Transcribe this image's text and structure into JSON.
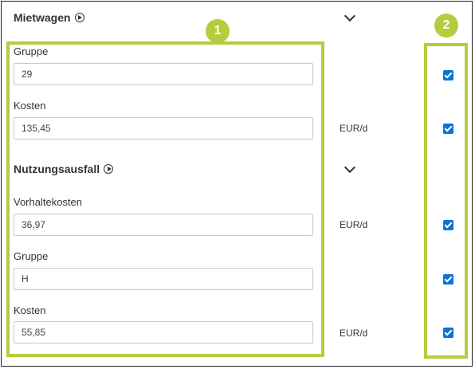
{
  "sections": {
    "mietwagen": {
      "title": "Mietwagen"
    },
    "nutzungsausfall": {
      "title": "Nutzungsausfall"
    }
  },
  "fields": {
    "mietwagen_gruppe": {
      "label": "Gruppe",
      "value": "29",
      "checked": true
    },
    "mietwagen_kosten": {
      "label": "Kosten",
      "value": "135,45",
      "unit": "EUR/d",
      "checked": true
    },
    "vorhaltekosten": {
      "label": "Vorhaltekosten",
      "value": "36,97",
      "unit": "EUR/d",
      "checked": true
    },
    "nutzung_gruppe": {
      "label": "Gruppe",
      "value": "H",
      "checked": true
    },
    "nutzung_kosten": {
      "label": "Kosten",
      "value": "55,85",
      "unit": "EUR/d",
      "checked": true
    }
  },
  "annotations": {
    "badge_1": "1",
    "badge_2": "2",
    "highlight_color": "#b5cc3d"
  },
  "colors": {
    "checkbox": "#0a74d6"
  }
}
